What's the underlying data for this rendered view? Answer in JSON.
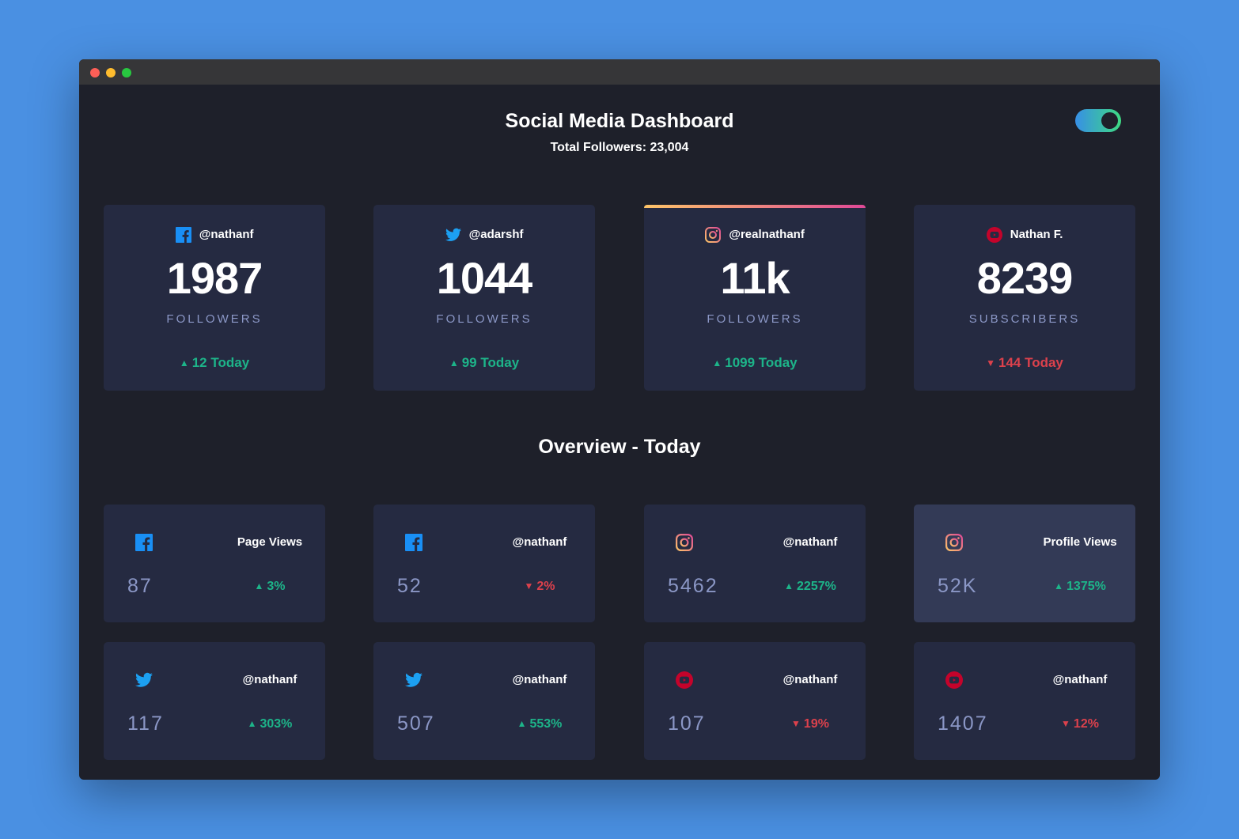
{
  "header": {
    "title": "Social Media Dashboard",
    "subtitle": "Total Followers: 23,004",
    "theme_toggle_on": true
  },
  "colors": {
    "facebook": "#198ff5",
    "twitter": "#1ca0f2",
    "instagram_start": "#fdc468",
    "instagram_end": "#df4996",
    "youtube": "#c4032b",
    "up": "#1db489",
    "down": "#dc414c"
  },
  "followers": [
    {
      "icon": "facebook-icon",
      "handle": "@nathanf",
      "count": "1987",
      "label": "FOLLOWERS",
      "change": "12 Today",
      "direction": "up"
    },
    {
      "icon": "twitter-icon",
      "handle": "@adarshf",
      "count": "1044",
      "label": "FOLLOWERS",
      "change": "99 Today",
      "direction": "up"
    },
    {
      "icon": "instagram-icon",
      "handle": "@realnathanf",
      "count": "11k",
      "label": "FOLLOWERS",
      "change": "1099 Today",
      "direction": "up"
    },
    {
      "icon": "youtube-icon",
      "handle": "Nathan F.",
      "count": "8239",
      "label": "SUBSCRIBERS",
      "change": "144 Today",
      "direction": "down"
    }
  ],
  "overview_title": "Overview - Today",
  "overview": [
    {
      "icon": "facebook-icon",
      "title": "Page Views",
      "value": "87",
      "change": "3%",
      "direction": "up"
    },
    {
      "icon": "facebook-icon",
      "title": "@nathanf",
      "value": "52",
      "change": "2%",
      "direction": "down"
    },
    {
      "icon": "instagram-icon",
      "title": "@nathanf",
      "value": "5462",
      "change": "2257%",
      "direction": "up"
    },
    {
      "icon": "instagram-icon",
      "title": "Profile Views",
      "value": "52K",
      "change": "1375%",
      "direction": "up"
    },
    {
      "icon": "twitter-icon",
      "title": "@nathanf",
      "value": "117",
      "change": "303%",
      "direction": "up"
    },
    {
      "icon": "twitter-icon",
      "title": "@nathanf",
      "value": "507",
      "change": "553%",
      "direction": "up"
    },
    {
      "icon": "youtube-icon",
      "title": "@nathanf",
      "value": "107",
      "change": "19%",
      "direction": "down"
    },
    {
      "icon": "youtube-icon",
      "title": "@nathanf",
      "value": "1407",
      "change": "12%",
      "direction": "down"
    }
  ]
}
